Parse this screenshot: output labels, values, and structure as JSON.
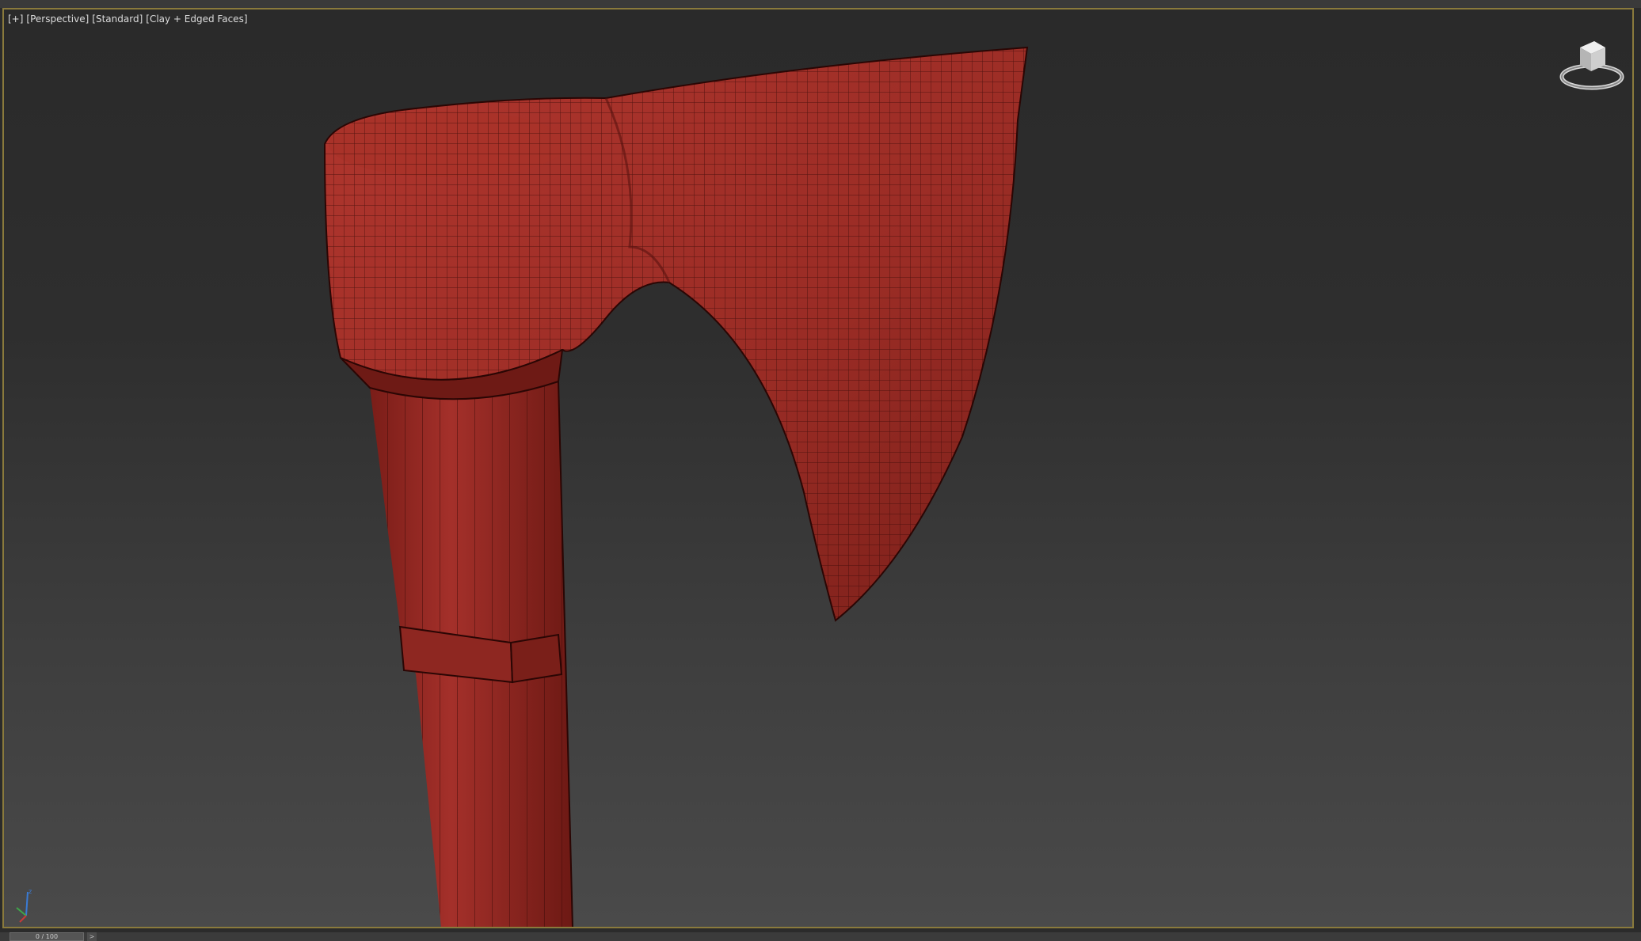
{
  "viewport": {
    "labels": [
      "[+]",
      "[Perspective]",
      "[Standard]",
      "[Clay + Edged Faces]"
    ],
    "border_color": "#8a7a3c"
  },
  "model": {
    "color": "#a4302a"
  },
  "icons": {
    "viewcube": "viewcube-icon",
    "axis": "axis-tripod-icon"
  },
  "timeline": {
    "frame_readout": "0 / 100",
    "next_label": ">"
  }
}
